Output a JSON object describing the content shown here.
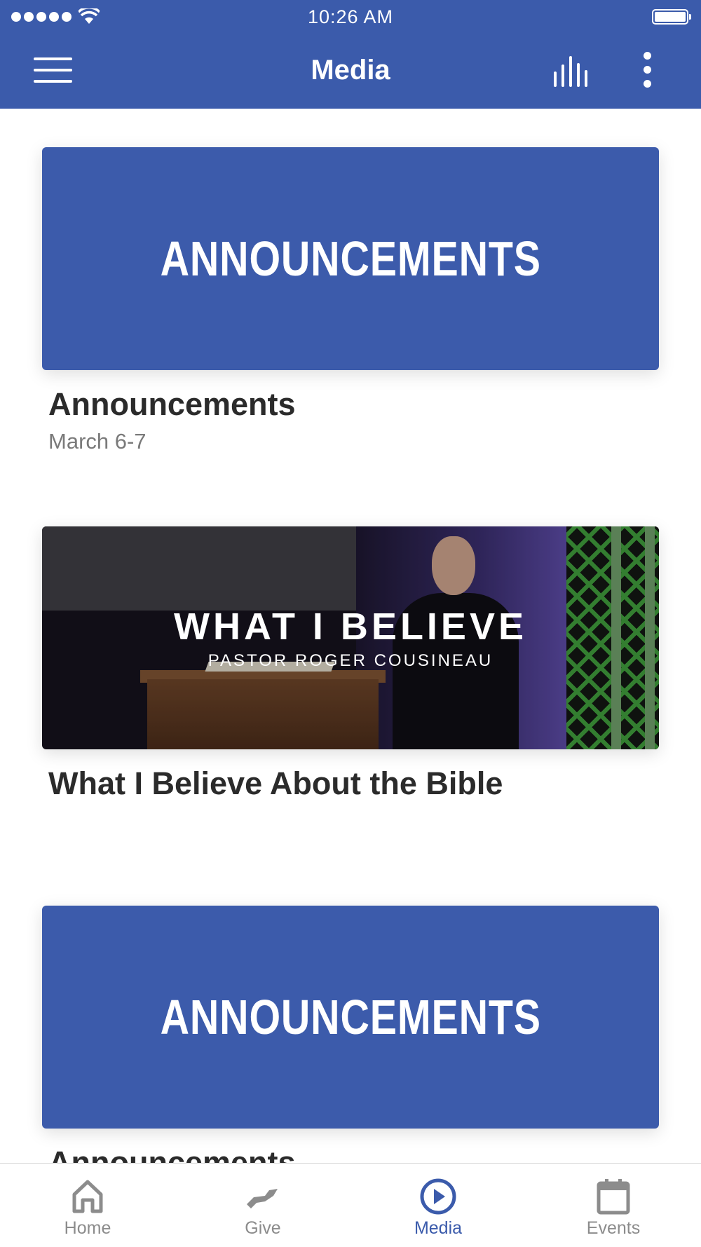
{
  "status_bar": {
    "time": "10:26 AM"
  },
  "header": {
    "title": "Media"
  },
  "media_items": [
    {
      "thumbnail_text": "ANNOUNCEMENTS",
      "title": "Announcements",
      "subtitle": "March 6-7"
    },
    {
      "thumbnail_title": "WHAT I BELIEVE",
      "thumbnail_subtitle": "PASTOR ROGER COUSINEAU",
      "title": "What I Believe About the Bible"
    },
    {
      "thumbnail_text": "ANNOUNCEMENTS",
      "title": "Announcements"
    }
  ],
  "tabs": [
    {
      "label": "Home",
      "icon": "home-icon",
      "active": false
    },
    {
      "label": "Give",
      "icon": "give-hand-icon",
      "active": false
    },
    {
      "label": "Media",
      "icon": "play-circle-icon",
      "active": true
    },
    {
      "label": "Events",
      "icon": "calendar-icon",
      "active": false
    }
  ],
  "colors": {
    "brand": "#3b5bab",
    "inactive_tab": "#8c8c8c",
    "title_text": "#2b2b2b",
    "subtitle_text": "#7a7a7a"
  }
}
